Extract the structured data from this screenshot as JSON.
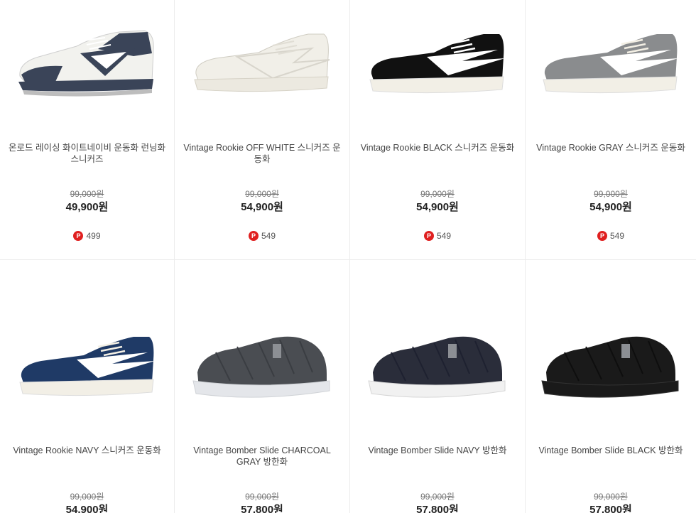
{
  "products": [
    {
      "name": "온로드 레이싱 화이트네이비 운동화 런닝화 스니커즈",
      "original_price": "99,000원",
      "price": "49,900원",
      "points": "499",
      "image": "white-navy-running-sneaker",
      "colors": {
        "body": "#f2f2ee",
        "accent": "#3a4458",
        "sole": "#e8e8e8"
      }
    },
    {
      "name": "Vintage Rookie OFF WHITE 스니커즈 운동화",
      "original_price": "99,000원",
      "price": "54,900원",
      "points": "549",
      "image": "off-white-sneaker",
      "colors": {
        "body": "#f1efe8",
        "accent": "#e6e3da",
        "sole": "#ece9e0"
      }
    },
    {
      "name": "Vintage Rookie BLACK 스니커즈 운동화",
      "original_price": "99,000원",
      "price": "54,900원",
      "points": "549",
      "image": "black-sneaker",
      "colors": {
        "body": "#111111",
        "accent": "#ffffff",
        "sole": "#f2efe6"
      }
    },
    {
      "name": "Vintage Rookie GRAY 스니커즈 운동화",
      "original_price": "99,000원",
      "price": "54,900원",
      "points": "549",
      "image": "gray-sneaker",
      "colors": {
        "body": "#8a8c8e",
        "accent": "#ffffff",
        "sole": "#f2efe6"
      }
    },
    {
      "name": "Vintage Rookie NAVY 스니커즈 운동화",
      "original_price": "99,000원",
      "price": "54,900원",
      "image": "navy-sneaker",
      "colors": {
        "body": "#1f3a66",
        "accent": "#ffffff",
        "sole": "#f2efe6"
      }
    },
    {
      "name": "Vintage Bomber Slide CHARCOAL GRAY 방한화",
      "original_price": "99,000원",
      "price": "57,800원",
      "image": "charcoal-padded-slide",
      "colors": {
        "body": "#4a4d52",
        "accent": "#3a3d42",
        "sole": "#e4e6ea"
      }
    },
    {
      "name": "Vintage Bomber Slide NAVY 방한화",
      "original_price": "99,000원",
      "price": "57,800원",
      "image": "navy-padded-slide",
      "colors": {
        "body": "#2a2d3a",
        "accent": "#1e2130",
        "sole": "#f1f1f1"
      }
    },
    {
      "name": "Vintage Bomber Slide BLACK 방한화",
      "original_price": "99,000원",
      "price": "57,800원",
      "image": "black-padded-slide",
      "colors": {
        "body": "#1a1a1a",
        "accent": "#0e0e0e",
        "sole": "#1a1a1a"
      }
    }
  ],
  "points_icon": "P",
  "colors": {
    "points_badge": "#e02020"
  }
}
